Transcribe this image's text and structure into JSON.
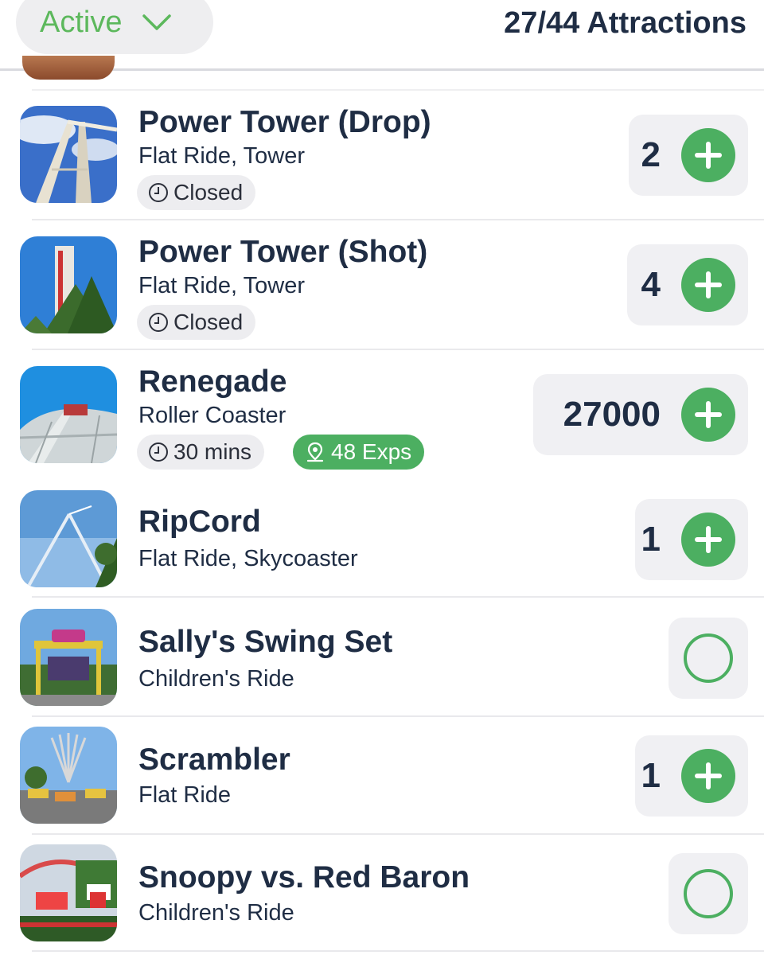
{
  "header": {
    "filter_label": "Active",
    "count_text": "27/44 Attractions"
  },
  "attractions": [
    {
      "name": "Power Tower (Drop)",
      "type": "Flat Ride, Tower",
      "status": "Closed",
      "count": "2"
    },
    {
      "name": "Power Tower (Shot)",
      "type": "Flat Ride, Tower",
      "status": "Closed",
      "count": "4"
    },
    {
      "name": "Renegade",
      "type": "Roller Coaster",
      "wait": "30 mins",
      "exps": "48 Exps",
      "count": "27000"
    },
    {
      "name": "RipCord",
      "type": "Flat Ride, Skycoaster",
      "count": "1"
    },
    {
      "name": "Sally's Swing Set",
      "type": "Children's Ride"
    },
    {
      "name": "Scrambler",
      "type": "Flat Ride",
      "count": "1"
    },
    {
      "name": "Snoopy vs. Red Baron",
      "type": "Children's Ride"
    }
  ],
  "colors": {
    "accent": "#4caf61",
    "text": "#1f2d44",
    "badge_bg": "#ededf0"
  }
}
